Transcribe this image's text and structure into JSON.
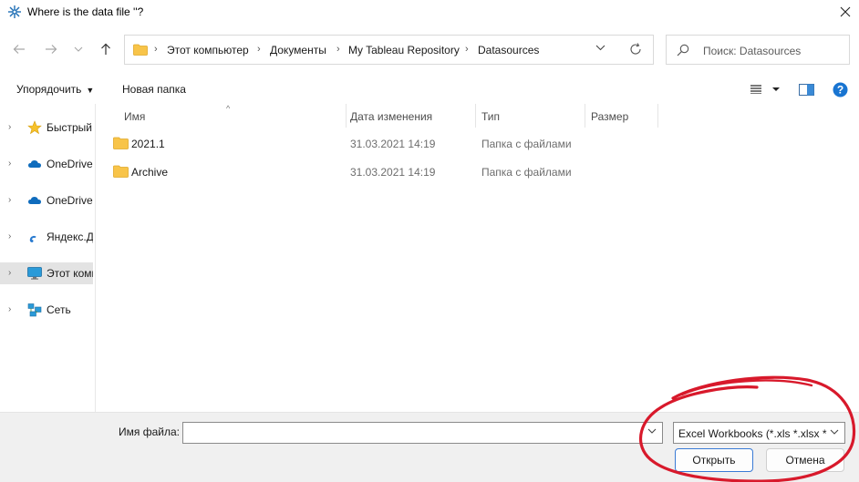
{
  "window": {
    "title": "Where is the data file ''?"
  },
  "address_bar": {
    "breadcrumbs": [
      "Этот компьютер",
      "Документы",
      "My Tableau Repository",
      "Datasources"
    ]
  },
  "search": {
    "placeholder": "Поиск: Datasources"
  },
  "toolbar": {
    "organize_label": "Упорядочить",
    "new_folder_label": "Новая папка"
  },
  "sidebar": {
    "items": [
      {
        "label": "Быстрый",
        "icon": "star-icon"
      },
      {
        "label": "OneDrive",
        "icon": "cloud-icon"
      },
      {
        "label": "OneDrive",
        "icon": "cloud-icon"
      },
      {
        "label": "Яндекс.Ди",
        "icon": "yandex-disk-icon"
      },
      {
        "label": "Этот компьютер",
        "icon": "computer-icon",
        "selected": true
      },
      {
        "label": "Сеть",
        "icon": "network-icon"
      }
    ]
  },
  "file_list": {
    "columns": [
      "Имя",
      "Дата изменения",
      "Тип",
      "Размер"
    ],
    "rows": [
      {
        "name": "2021.1",
        "date": "31.03.2021 14:19",
        "type": "Папка с файлами",
        "size": ""
      },
      {
        "name": "Archive",
        "date": "31.03.2021 14:19",
        "type": "Папка с файлами",
        "size": ""
      }
    ]
  },
  "footer": {
    "filename_label": "Имя файла:",
    "filename_value": "",
    "filter_value": "Excel Workbooks (*.xls *.xlsx *.xlsm)",
    "open_label": "Открыть",
    "cancel_label": "Отмена"
  },
  "colors": {
    "folder": "#f8c449",
    "accent": "#1874d1",
    "annotation": "#d8192b"
  }
}
